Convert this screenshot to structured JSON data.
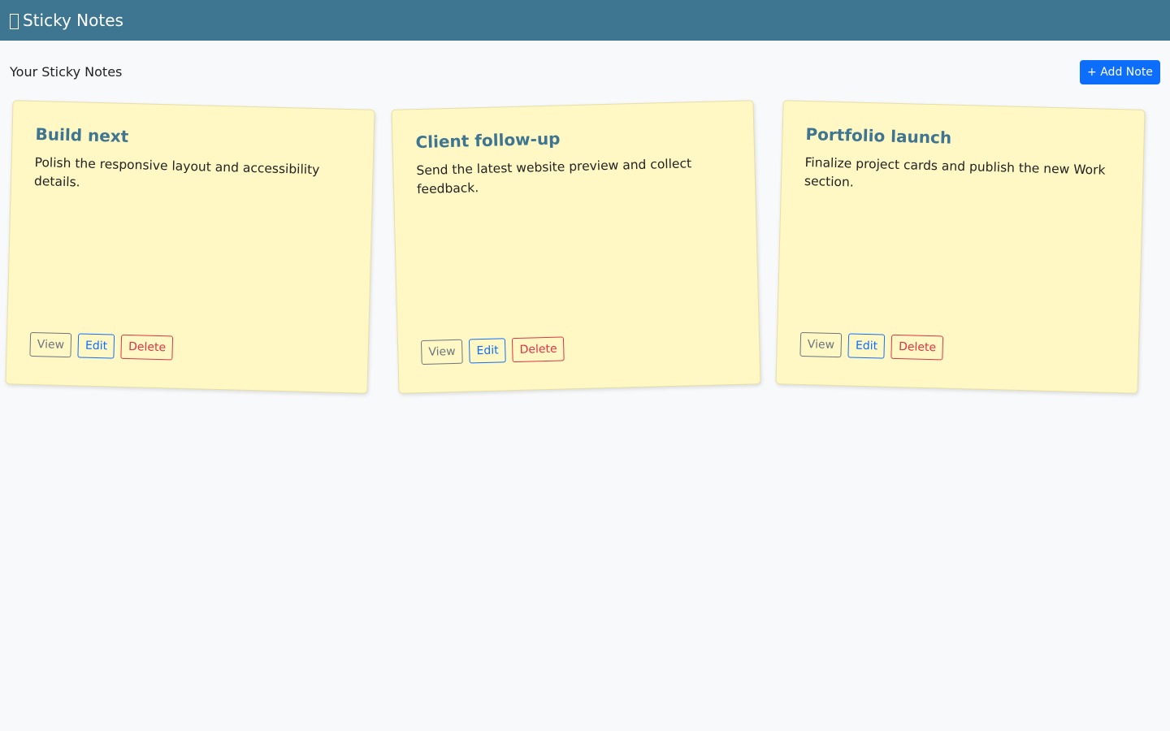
{
  "app": {
    "icon": "note-icon",
    "title": "Sticky Notes"
  },
  "page": {
    "heading": "Your Sticky Notes",
    "add_button_label": "+ Add Note"
  },
  "colors": {
    "navbar": "#3e7590",
    "note_background": "#fff8c4",
    "note_title": "#3e7590",
    "primary": "#0d6efd",
    "danger": "#dc3545",
    "secondary": "#6c757d"
  },
  "notes": [
    {
      "title": "Build next",
      "body": "Polish the responsive layout and accessibility details.",
      "actions": {
        "view": "View",
        "edit": "Edit",
        "delete": "Delete"
      }
    },
    {
      "title": "Client follow-up",
      "body": "Send the latest website preview and collect feedback.",
      "actions": {
        "view": "View",
        "edit": "Edit",
        "delete": "Delete"
      }
    },
    {
      "title": "Portfolio launch",
      "body": "Finalize project cards and publish the new Work section.",
      "actions": {
        "view": "View",
        "edit": "Edit",
        "delete": "Delete"
      }
    }
  ]
}
